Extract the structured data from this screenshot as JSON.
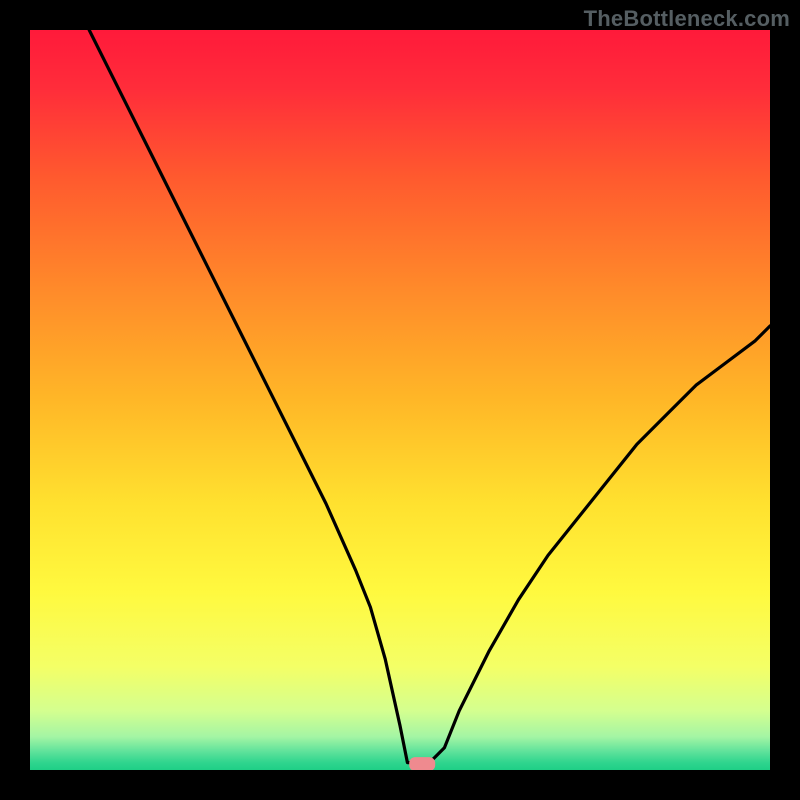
{
  "watermark": "TheBottleneck.com",
  "chart_data": {
    "type": "line",
    "title": "",
    "xlabel": "",
    "ylabel": "",
    "xlim": [
      0,
      100
    ],
    "ylim": [
      0,
      100
    ],
    "series": [
      {
        "name": "bottleneck-curve",
        "x": [
          8,
          12,
          16,
          20,
          24,
          28,
          32,
          36,
          40,
          44,
          46,
          48,
          50,
          51,
          52,
          54,
          56,
          58,
          62,
          66,
          70,
          74,
          78,
          82,
          86,
          90,
          94,
          98,
          100
        ],
        "y": [
          100,
          92,
          84,
          76,
          68,
          60,
          52,
          44,
          36,
          27,
          22,
          15,
          6,
          1,
          1,
          1,
          3,
          8,
          16,
          23,
          29,
          34,
          39,
          44,
          48,
          52,
          55,
          58,
          60
        ]
      }
    ],
    "marker": {
      "x": 53,
      "y": 0.8
    },
    "gradient_stops": [
      {
        "offset": 0.0,
        "color": "#ff1a3a"
      },
      {
        "offset": 0.08,
        "color": "#ff2d3a"
      },
      {
        "offset": 0.2,
        "color": "#ff5a2e"
      },
      {
        "offset": 0.35,
        "color": "#ff8a2a"
      },
      {
        "offset": 0.5,
        "color": "#ffb727"
      },
      {
        "offset": 0.64,
        "color": "#ffe12f"
      },
      {
        "offset": 0.76,
        "color": "#fff93f"
      },
      {
        "offset": 0.86,
        "color": "#f4ff66"
      },
      {
        "offset": 0.92,
        "color": "#d4ff8f"
      },
      {
        "offset": 0.955,
        "color": "#a4f5a4"
      },
      {
        "offset": 0.975,
        "color": "#5fe29b"
      },
      {
        "offset": 0.99,
        "color": "#2fd58e"
      },
      {
        "offset": 1.0,
        "color": "#1fcf86"
      }
    ]
  }
}
